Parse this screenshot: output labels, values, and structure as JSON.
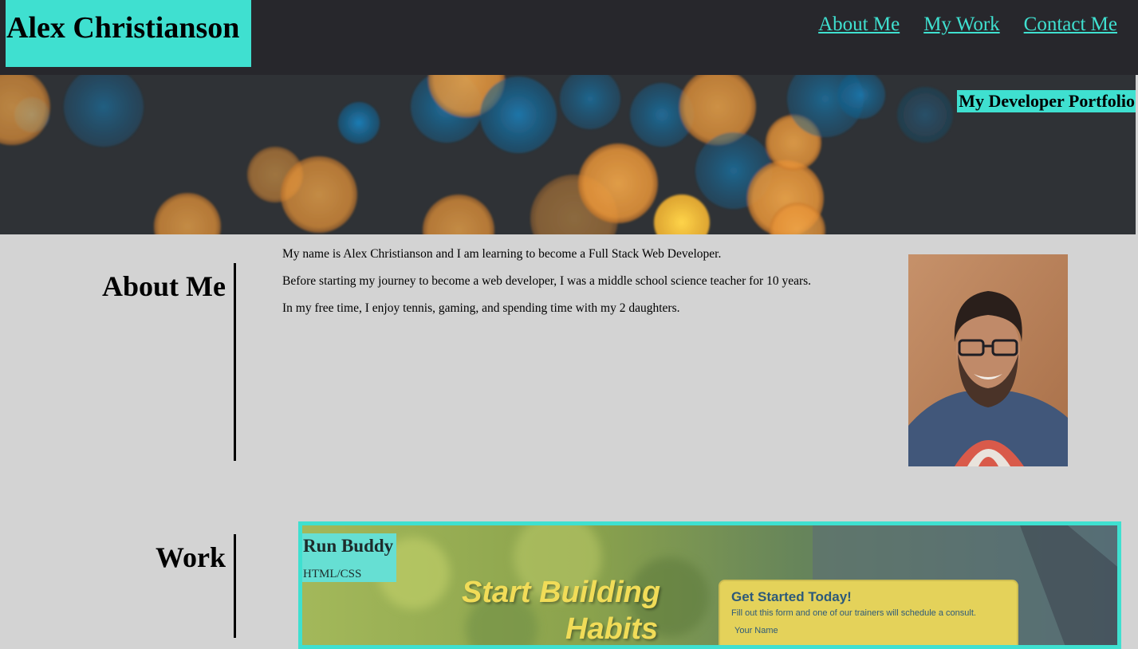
{
  "header": {
    "name": "Alex Christianson",
    "nav": [
      "About Me",
      "My Work",
      "Contact Me"
    ]
  },
  "hero": {
    "title": "My Developer Portfolio"
  },
  "about": {
    "heading": "About Me",
    "paragraphs": [
      "My name is Alex Christianson and I am learning to become a Full Stack Web Developer.",
      "Before starting my journey to become a web developer, I was a middle school science teacher for 10 years.",
      "In my free time, I enjoy tennis, gaming, and spending time with my 2 daughters."
    ]
  },
  "work": {
    "heading": "Work",
    "projects": [
      {
        "title": "Run Buddy",
        "tech": "HTML/CSS",
        "screenshot": {
          "headline_line1": "Start Building",
          "headline_line2": "Habits",
          "form_title": "Get Started Today!",
          "form_subtitle": "Fill out this form and one of our trainers will schedule a consult.",
          "form_field_label": "Your Name"
        }
      }
    ]
  },
  "colors": {
    "accent": "#3fe0d0",
    "header_bg": "#27272c",
    "page_bg": "#d3d3d3"
  }
}
